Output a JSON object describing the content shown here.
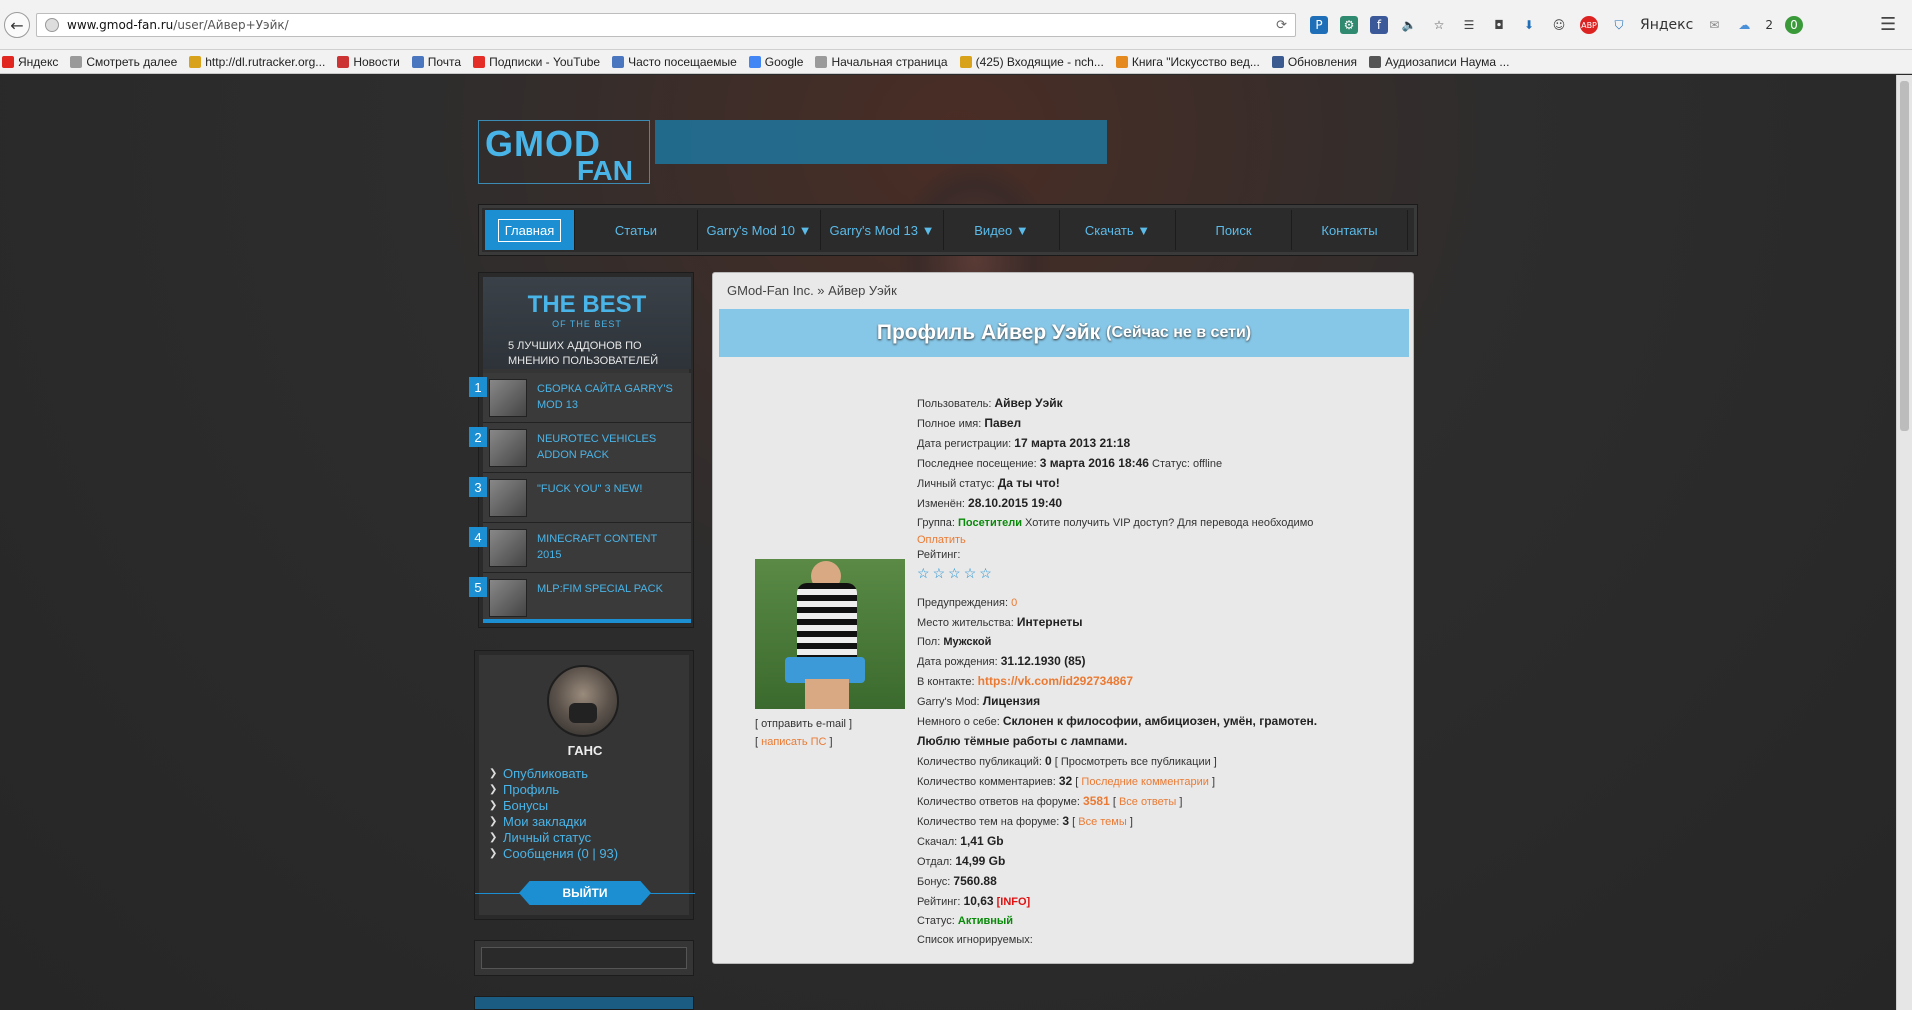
{
  "browser": {
    "url_host": "www.gmod-fan.ru",
    "url_path": "/user/Айвер+Уэйк/",
    "toolbar_search_label": "Яндекс",
    "cloud_count": "2",
    "icons": [
      "reload-icon",
      "pocket-icon",
      "facebook-icon",
      "sound-icon",
      "star-icon",
      "reader-icon",
      "shield-icon",
      "download-icon",
      "chat-icon",
      "adblock-icon",
      "yandex-icon",
      "mail-icon",
      "cloud-icon",
      "menu-icon"
    ]
  },
  "bookmarks": [
    {
      "label": "Яндекс",
      "color": "#e0261f"
    },
    {
      "label": "Смотреть далее",
      "color": "#9a9a9a"
    },
    {
      "label": "http://dl.rutracker.org...",
      "color": "#d8a21b"
    },
    {
      "label": "Новости",
      "color": "#cc3333"
    },
    {
      "label": "Почта",
      "color": "#4a76c0"
    },
    {
      "label": "Подписки - YouTube",
      "color": "#e52d27"
    },
    {
      "label": "Часто посещаемые",
      "color": "#4a76c0"
    },
    {
      "label": "Google",
      "color": "#4285f4"
    },
    {
      "label": "Начальная страница",
      "color": "#9a9a9a"
    },
    {
      "label": "(425) Входящие - nch...",
      "color": "#d8a21b"
    },
    {
      "label": "Книга \"Искусство вед...",
      "color": "#e58a1f"
    },
    {
      "label": "Обновления",
      "color": "#3a5a90"
    },
    {
      "label": "Аудиозаписи Наума ...",
      "color": "#555555"
    }
  ],
  "site": {
    "logo_line1": "GMOD",
    "logo_line2": "FAN",
    "nav": [
      {
        "label": "Главная",
        "active": true
      },
      {
        "label": "Статьи"
      },
      {
        "label": "Garry's Mod 10 ▼"
      },
      {
        "label": "Garry's Mod 13 ▼"
      },
      {
        "label": "Видео ▼"
      },
      {
        "label": "Скачать ▼"
      },
      {
        "label": "Поиск"
      },
      {
        "label": "Контакты"
      }
    ]
  },
  "best": {
    "title": "THE BEST",
    "subtitle": "OF THE BEST",
    "desc": "5 ЛУЧШИХ АДДОНОВ ПО МНЕНИЮ ПОЛЬЗОВАТЕЛЕЙ",
    "items": [
      {
        "num": "1",
        "label": "Сборка сайта Garry's Mod 13"
      },
      {
        "num": "2",
        "label": "Neurotec Vehicles Addon Pack"
      },
      {
        "num": "3",
        "label": "\"Fuck You\" 3 New!"
      },
      {
        "num": "4",
        "label": "Minecraft Content 2015"
      },
      {
        "num": "5",
        "label": "MLP:FiM Special Pack"
      }
    ]
  },
  "user_panel": {
    "name": "ГАНС",
    "menu": [
      "Опубликовать",
      "Профиль",
      "Бонусы",
      "Мои закладки",
      "Личный статус",
      "Сообщения (0 | 93)"
    ],
    "logout": "ВЫЙТИ"
  },
  "content": {
    "breadcrumb": "GMod-Fan Inc. » Айвер Уэйк",
    "profile_title": "Профиль Айвер Уэйк",
    "profile_status": "(Сейчас не в сети)",
    "send_email": "[ отправить e-mail ]",
    "write_pm_open": "[",
    "write_pm": "написать ПС",
    "write_pm_close": "]",
    "fields": {
      "user_label": "Пользователь:",
      "user": "Айвер Уэйк",
      "fullname_label": "Полное имя:",
      "fullname": "Павел",
      "reg_label": "Дата регистрации:",
      "reg": "17 марта 2013 21:18",
      "last_label": "Последнее посещение:",
      "last": "3 марта 2016 18:46",
      "status_inline_label": "Статус:",
      "status_inline": "offline",
      "personal_label": "Личный статус:",
      "personal": "Да ты что!",
      "changed_label": "Изменён:",
      "changed": "28.10.2015 19:40",
      "group_label": "Группа:",
      "group": "Посетители",
      "vip_text": "Хотите получить VIP доступ? Для перевода необходимо",
      "pay": "Оплатить",
      "rating_label": "Рейтинг:",
      "warn_label": "Предупреждения:",
      "warn": "0",
      "place_label": "Место жительства:",
      "place": "Интернеты",
      "gender_label": "Пол:",
      "gender": "Мужской",
      "birth_label": "Дата рождения:",
      "birth": "31.12.1930 (85)",
      "vk_label": "В контакте:",
      "vk": "https://vk.com/id292734867",
      "gmod_label": "Garry's Mod:",
      "gmod": "Лицензия",
      "about_label": "Немного о себе:",
      "about1": "Склонен к философии, амбициозен, умён, грамотен.",
      "about2": "Люблю тёмные работы с лампами.",
      "pubs_label": "Количество публикаций:",
      "pubs": "0",
      "pubs_link": "[ Просмотреть все публикации ]",
      "comments_label": "Количество комментариев:",
      "comments": "32",
      "comments_open": "[",
      "comments_link": "Последние комментарии",
      "comments_close": "]",
      "answers_label": "Количество ответов на форуме:",
      "answers": "3581",
      "answers_open": "[",
      "answers_link": "Все ответы",
      "answers_close": "]",
      "topics_label": "Количество тем на форуме:",
      "topics": "3",
      "topics_open": "[",
      "topics_link": "Все темы",
      "topics_close": "]",
      "downloaded_label": "Скачал:",
      "downloaded": "1,41 Gb",
      "uploaded_label": "Отдал:",
      "uploaded": "14,99 Gb",
      "bonus_label": "Бонус:",
      "bonus": "7560.88",
      "rating2_label": "Рейтинг:",
      "rating2": "10,63",
      "rating2_info": "[INFO]",
      "status_label": "Статус:",
      "status": "Активный",
      "ignore_label": "Список игнорируемых:"
    }
  },
  "colors": {
    "accent": "#1b8fd2",
    "link_blue": "#49b4e8",
    "link_orange": "#ea7a33",
    "green": "#0a8a0a"
  }
}
